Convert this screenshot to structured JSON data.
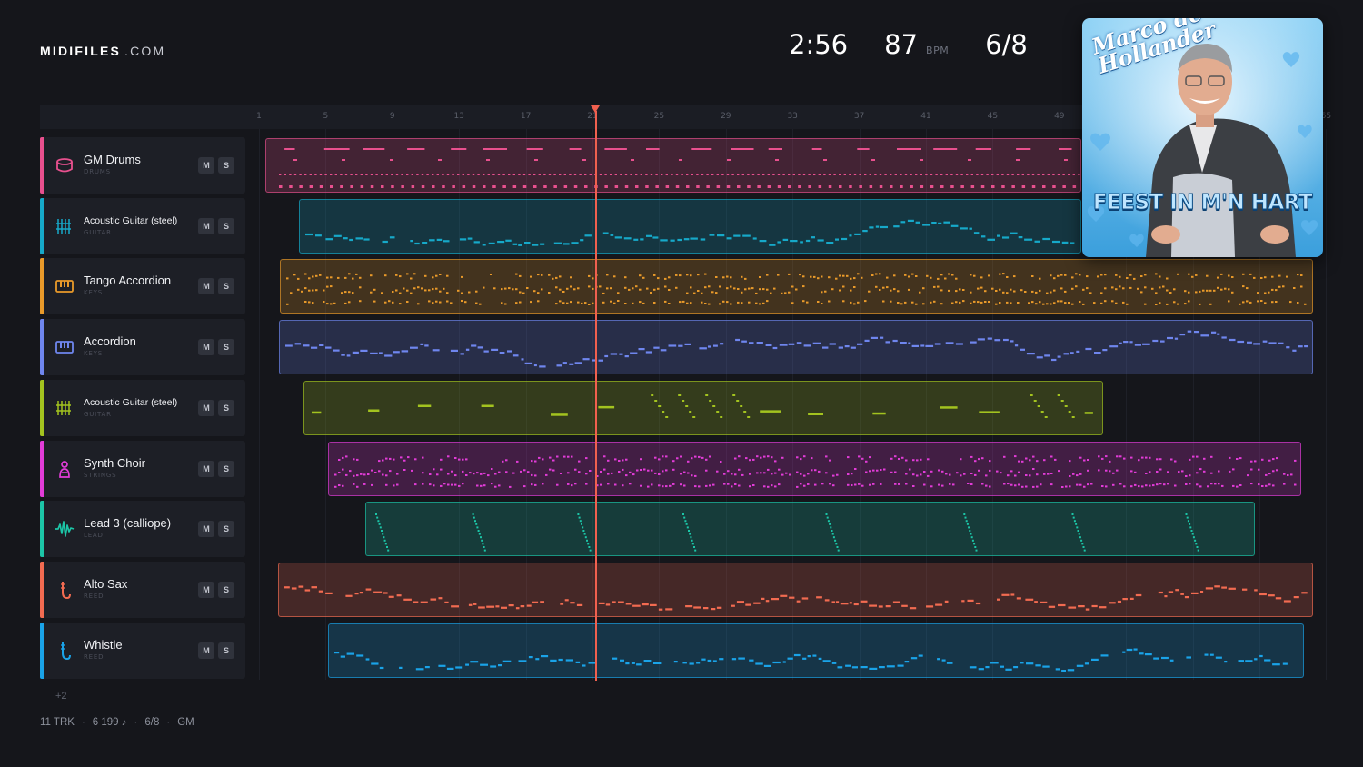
{
  "brand": {
    "bold": "MIDIFILES",
    "light": ".COM"
  },
  "transport": {
    "time": "2:56",
    "tempo": "87",
    "tempo_unit": "BPM",
    "meter": "6/8"
  },
  "album": {
    "artist": "Marco de Hollander",
    "title": "FEEST IN M'N HART"
  },
  "ruler": [
    "1",
    "5",
    "9",
    "13",
    "17",
    "21",
    "25",
    "29",
    "33",
    "37",
    "41",
    "45",
    "49",
    "53",
    "57",
    "61",
    "65"
  ],
  "playhead_bar": 21,
  "tracks": [
    {
      "name": "GM Drums",
      "category": "DRUMS",
      "color": "#e8508e",
      "icon": "drum-icon",
      "mute": "M",
      "solo": "S"
    },
    {
      "name": "Acoustic Guitar (steel)",
      "category": "GUITAR",
      "color": "#16a9c9",
      "icon": "guitar-icon",
      "mute": "M",
      "solo": "S"
    },
    {
      "name": "Tango Accordion",
      "category": "KEYS",
      "color": "#e99a2a",
      "icon": "keys-icon",
      "mute": "M",
      "solo": "S"
    },
    {
      "name": "Accordion",
      "category": "KEYS",
      "color": "#6f86ee",
      "icon": "keys-icon",
      "mute": "M",
      "solo": "S"
    },
    {
      "name": "Acoustic Guitar (steel)",
      "category": "GUITAR",
      "color": "#a3c31f",
      "icon": "guitar-icon",
      "mute": "M",
      "solo": "S"
    },
    {
      "name": "Synth Choir",
      "category": "STRINGS",
      "color": "#e23cd8",
      "icon": "choir-icon",
      "mute": "M",
      "solo": "S"
    },
    {
      "name": "Lead 3 (calliope)",
      "category": "LEAD",
      "color": "#1cc5a7",
      "icon": "wave-icon",
      "mute": "M",
      "solo": "S"
    },
    {
      "name": "Alto Sax",
      "category": "REED",
      "color": "#f26b51",
      "icon": "sax-icon",
      "mute": "M",
      "solo": "S"
    },
    {
      "name": "Whistle",
      "category": "REED",
      "color": "#1aa3e8",
      "icon": "sax-icon",
      "mute": "M",
      "solo": "S"
    }
  ],
  "more_tracks": "+2",
  "footer": {
    "tracks": "11 TRK",
    "notes": "6 199 ♪",
    "meter": "6/8",
    "standard": "GM"
  }
}
